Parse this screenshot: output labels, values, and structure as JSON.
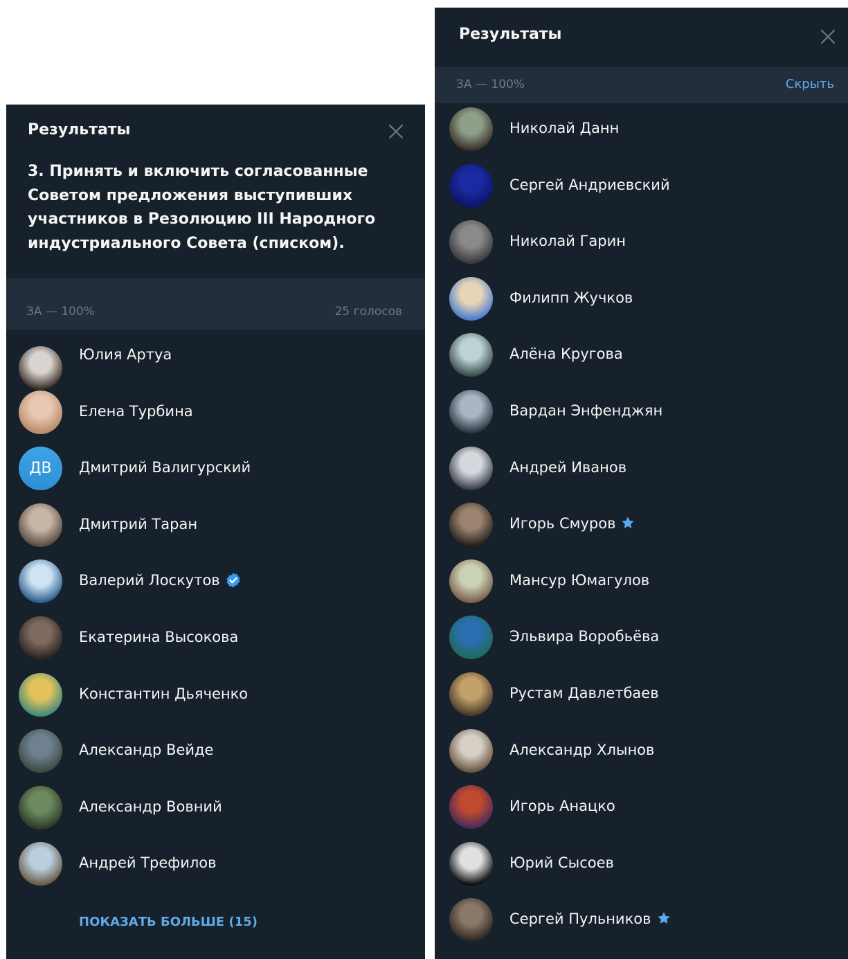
{
  "left": {
    "title": "Результаты",
    "question": "3. Принять и включить согласованные Советом предложения выступивших участников в Резолюцию III Народного индустриального Совета (списком).",
    "section_label": "ЗА — 100%",
    "votes_count": "25 голосов",
    "voters": [
      {
        "name": "Юлия Артуа",
        "badge": "",
        "colors": [
          "#d9d4cf",
          "#3a2f2a"
        ]
      },
      {
        "name": "Елена Турбина",
        "badge": "",
        "colors": [
          "#e9c7b3",
          "#b78a6a"
        ]
      },
      {
        "name": "Дмитрий Валигурский",
        "badge": "",
        "initials": "ДВ"
      },
      {
        "name": "Дмитрий Таран",
        "badge": "",
        "colors": [
          "#c8b7a6",
          "#5a4a40"
        ]
      },
      {
        "name": "Валерий Лоскутов",
        "badge": "verified",
        "colors": [
          "#cfe3f2",
          "#2c5f8f"
        ]
      },
      {
        "name": "Екатерина Высокова",
        "badge": "",
        "colors": [
          "#7e6a60",
          "#2a2320"
        ]
      },
      {
        "name": "Константин Дьяченко",
        "badge": "",
        "colors": [
          "#e3c25b",
          "#3f8b7a"
        ]
      },
      {
        "name": "Александр Вейде",
        "badge": "",
        "colors": [
          "#6f8090",
          "#3d4a40"
        ]
      },
      {
        "name": "Александр Вовний",
        "badge": "",
        "colors": [
          "#6c8a5e",
          "#2c3a2a"
        ]
      },
      {
        "name": "Андрей Трефилов",
        "badge": "",
        "colors": [
          "#b9cfe0",
          "#6c5a48"
        ]
      }
    ],
    "show_more": "ПОКАЗАТЬ БОЛЬШЕ (15)"
  },
  "right": {
    "title": "Результаты",
    "section_label": "ЗА — 100%",
    "hide_label": "Скрыть",
    "voters": [
      {
        "name": "Николай Данн",
        "badge": "",
        "colors": [
          "#8fa08a",
          "#3b3028"
        ]
      },
      {
        "name": "Сергей Андриевский",
        "badge": "",
        "colors": [
          "#1b2aa0",
          "#0c146a"
        ]
      },
      {
        "name": "Николай Гарин",
        "badge": "",
        "colors": [
          "#8a8a8a",
          "#3a3a3a"
        ]
      },
      {
        "name": "Филипп Жучков",
        "badge": "",
        "colors": [
          "#e7d6b6",
          "#4c7dcf"
        ]
      },
      {
        "name": "Алёна Кругова",
        "badge": "",
        "colors": [
          "#bcd3d4",
          "#3a4c4e"
        ]
      },
      {
        "name": "Вардан Энфенджян",
        "badge": "",
        "colors": [
          "#aab6c4",
          "#2c3542"
        ]
      },
      {
        "name": "Андрей Иванов",
        "badge": "",
        "colors": [
          "#d5d9de",
          "#3a3f48"
        ]
      },
      {
        "name": "Игорь Смуров",
        "badge": "star",
        "colors": [
          "#9a8470",
          "#2a231d"
        ]
      },
      {
        "name": "Мансур Юмагулов",
        "badge": "",
        "colors": [
          "#c9d2b4",
          "#7a5e4a"
        ]
      },
      {
        "name": "Эльвира Воробьёва",
        "badge": "",
        "colors": [
          "#2a6fb1",
          "#1f6a5a"
        ]
      },
      {
        "name": "Рустам Давлетбаев",
        "badge": "",
        "colors": [
          "#c4a06c",
          "#4a3a2a"
        ]
      },
      {
        "name": "Александр Хлынов",
        "badge": "",
        "colors": [
          "#d6cfc6",
          "#6a5442"
        ]
      },
      {
        "name": "Игорь Анацко",
        "badge": "",
        "colors": [
          "#c04a2e",
          "#4a2a5a"
        ]
      },
      {
        "name": "Юрий Сысоев",
        "badge": "",
        "colors": [
          "#e0e0e0",
          "#0d0d0d"
        ]
      },
      {
        "name": "Сергей Пульников",
        "badge": "star",
        "colors": [
          "#8a7868",
          "#2e2622"
        ]
      }
    ]
  }
}
